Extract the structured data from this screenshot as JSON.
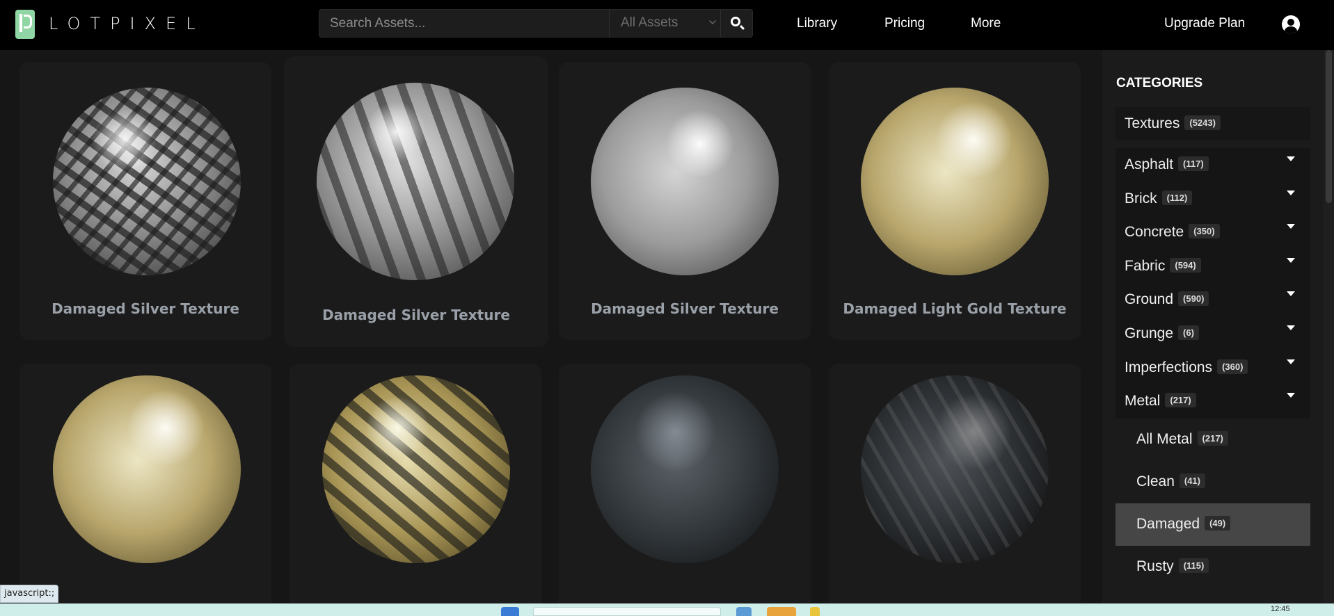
{
  "header": {
    "logo_text": "LOTPIXEL",
    "search_placeholder": "Search Assets...",
    "search_scope": "All Assets",
    "nav": [
      "Library",
      "Pricing",
      "More"
    ],
    "upgrade_label": "Upgrade Plan"
  },
  "assets": [
    {
      "name": "Damaged Silver Texture"
    },
    {
      "name": "Damaged Silver Texture"
    },
    {
      "name": "Damaged Silver Texture"
    },
    {
      "name": "Damaged Light Gold Texture"
    },
    {
      "name": ""
    },
    {
      "name": ""
    },
    {
      "name": ""
    },
    {
      "name": ""
    }
  ],
  "sidebar": {
    "title": "CATEGORIES",
    "top": {
      "label": "Textures",
      "count": "(5243)"
    },
    "categories": [
      {
        "label": "Asphalt",
        "count": "(117)"
      },
      {
        "label": "Brick",
        "count": "(112)"
      },
      {
        "label": "Concrete",
        "count": "(350)"
      },
      {
        "label": "Fabric",
        "count": "(594)"
      },
      {
        "label": "Ground",
        "count": "(590)"
      },
      {
        "label": "Grunge",
        "count": "(6)"
      },
      {
        "label": "Imperfections",
        "count": "(360)"
      },
      {
        "label": "Metal",
        "count": "(217)"
      }
    ],
    "metal_sub": [
      {
        "label": "All Metal",
        "count": "(217)"
      },
      {
        "label": "Clean",
        "count": "(41)"
      },
      {
        "label": "Damaged",
        "count": "(49)"
      },
      {
        "label": "Rusty",
        "count": "(115)"
      }
    ]
  },
  "status_bar": "javascript:;",
  "clock": "12:45"
}
